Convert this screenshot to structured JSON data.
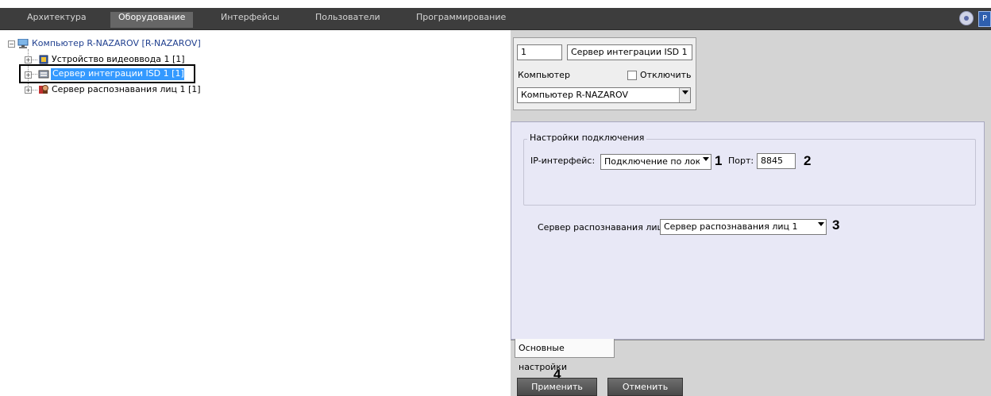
{
  "menu": {
    "items": [
      "Архитектура",
      "Оборудование",
      "Интерфейсы",
      "Пользователи",
      "Программирование"
    ],
    "active_index": 1,
    "corner_label": "Р"
  },
  "tree": {
    "root": "Компьютер R-NAZAROV [R-NAZAROV]",
    "children": [
      "Устройство видеоввода 1 [1]",
      "Сервер интеграции ISD 1 [1]",
      "Сервер распознавания лиц 1 [1]"
    ],
    "selected_index": 1
  },
  "object": {
    "id": "1",
    "name": "Сервер интеграции ISD 1",
    "computer_label": "Компьютер",
    "disable_label": "Отключить",
    "computer_value": "Компьютер R-NAZAROV"
  },
  "connection": {
    "group_title": "Настройки подключения",
    "ip_label": "IP-интерфейс:",
    "ip_value": "Подключение по лока",
    "port_label": "Порт:",
    "port_value": "8845"
  },
  "face_server": {
    "label": "Сервер распознавания лиц:",
    "value": "Сервер распознавания лиц 1"
  },
  "callouts": [
    "1",
    "2",
    "3",
    "4"
  ],
  "tabs": [
    "Основные настройки"
  ],
  "buttons": {
    "apply": "Применить",
    "cancel": "Отменить"
  },
  "colors": {
    "menubar": "#3d3d3d",
    "tree_text": "#1f3f8f",
    "selection": "#3399ff",
    "panel_bg": "#e8e8f6"
  }
}
